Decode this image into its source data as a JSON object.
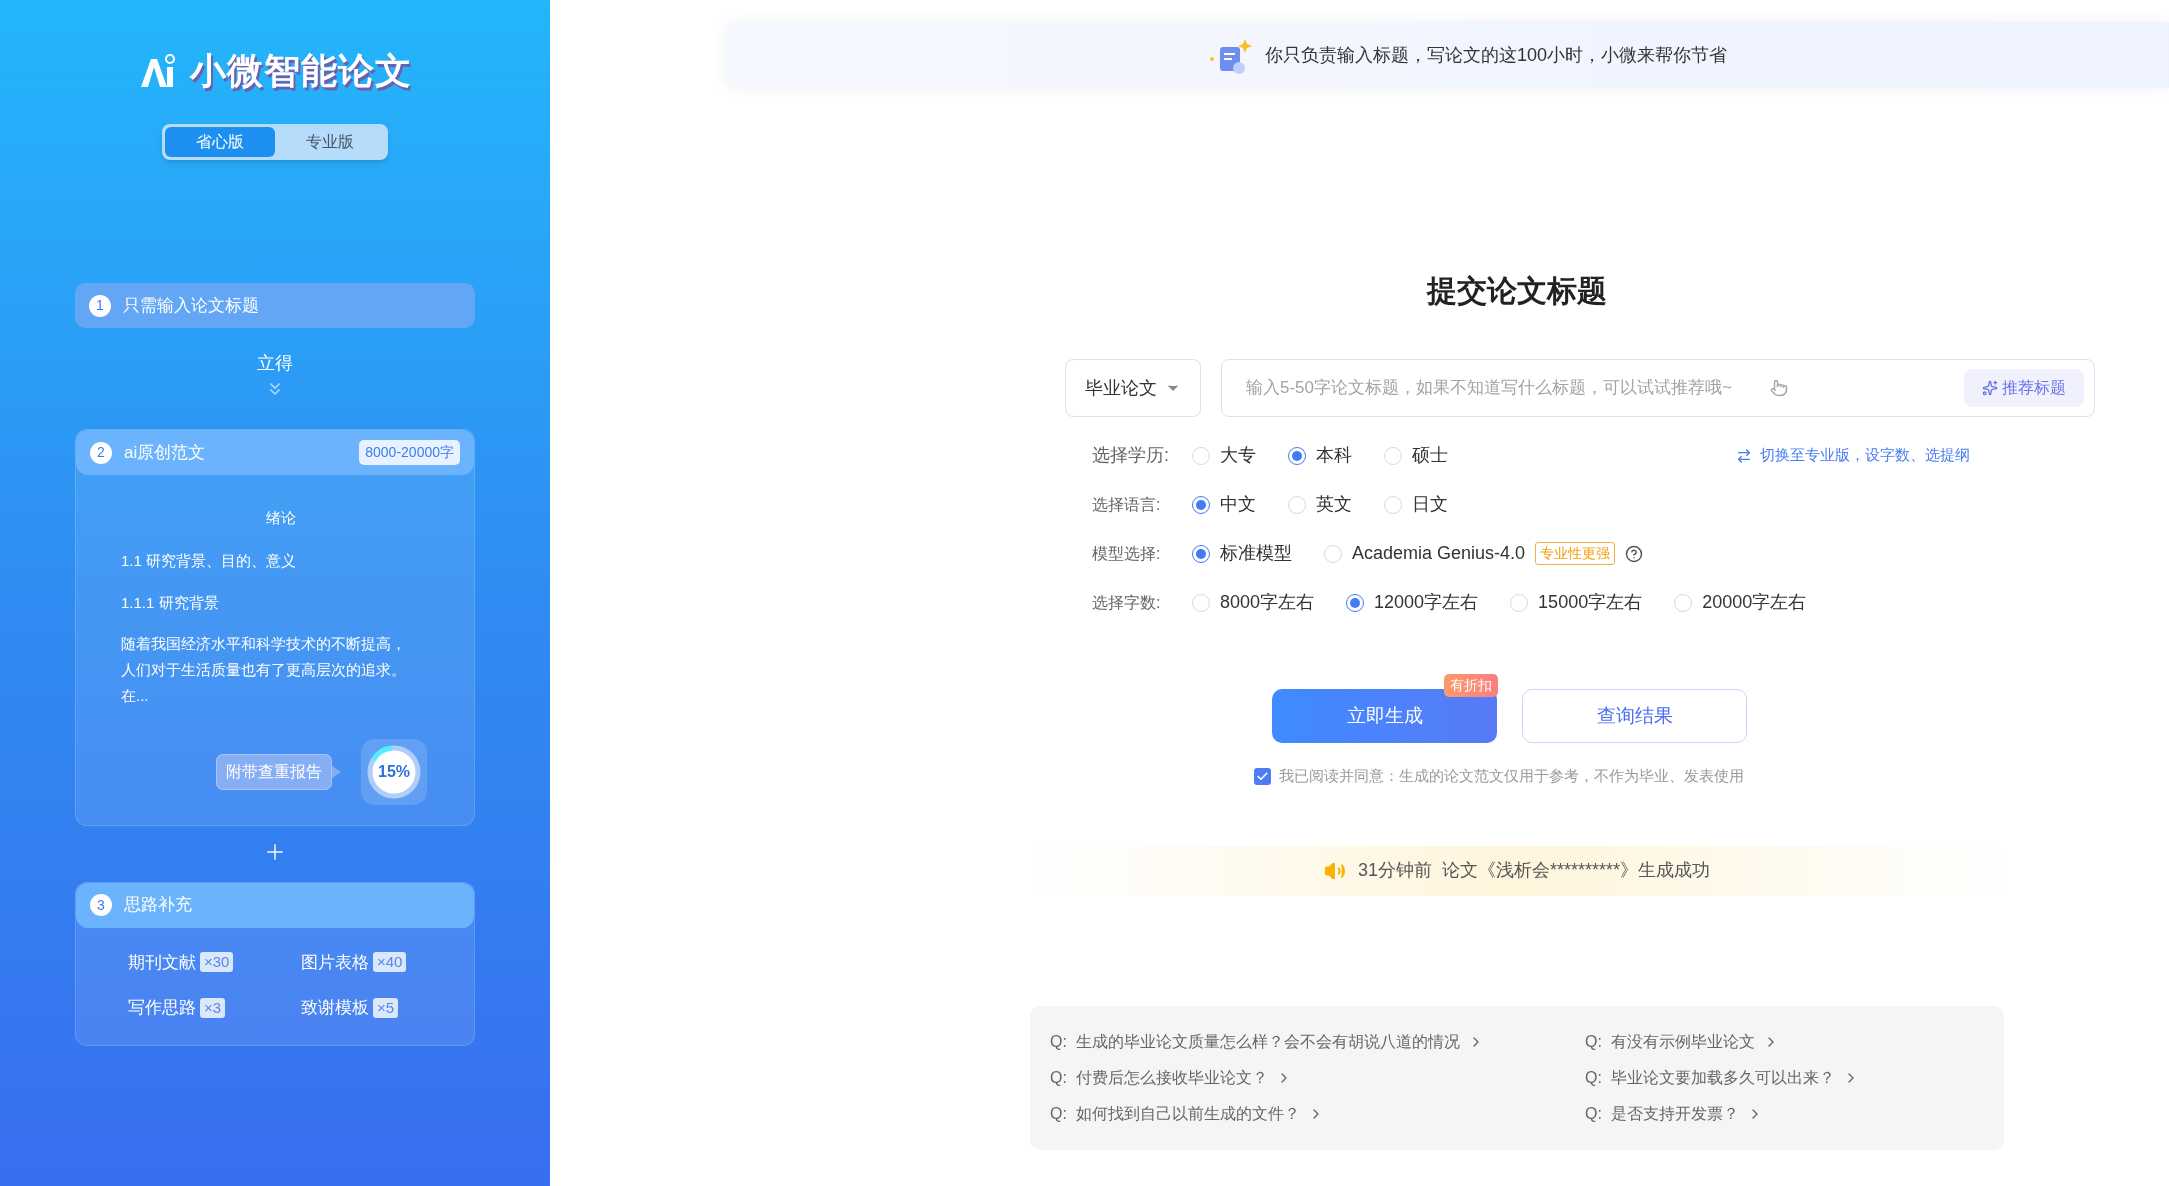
{
  "sidebar": {
    "logo_text": "小微智能论文",
    "version_tabs": [
      {
        "label": "省心版",
        "selected": true
      },
      {
        "label": "专业版",
        "selected": false
      }
    ],
    "step_1": {
      "number": "1",
      "title": "只需输入论文标题"
    },
    "connector_text": "立得",
    "step_2": {
      "number": "2",
      "title": "ai原创范文",
      "badge": "8000-20000字",
      "preview_heading": "绪论",
      "preview_lines": [
        "1.1 研究背景、目的、意义",
        "1.1.1 研究背景"
      ],
      "preview_paragraph": "随着我国经济水平和科学技术的不断提高，人们对于生活质量也有了更高层次的追求。在...",
      "report_label": "附带查重报告",
      "similarity": {
        "text": "15%",
        "level": 0.15
      }
    },
    "step_3": {
      "number": "3",
      "title": "思路补充",
      "items": [
        {
          "label": "期刊文献",
          "count": "×30"
        },
        {
          "label": "图片表格",
          "count": "×40"
        },
        {
          "label": "写作思路",
          "count": "×3"
        },
        {
          "label": "致谢模板",
          "count": "×5"
        }
      ]
    }
  },
  "banner": {
    "text": "你只负责输入标题，写论文的这100小时，小微来帮你节省"
  },
  "main": {
    "title": "提交论文标题",
    "type_dropdown": "毕业论文",
    "title_input": {
      "placeholder": "输入5-50字论文标题，如果不知道写什么标题，可以试试推荐哦~"
    },
    "recommend_button": "推荐标题",
    "switch_link": "切换至专业版，设字数、选提纲",
    "option_rows": [
      {
        "label": "选择学历:",
        "options": [
          {
            "label": "大专",
            "selected": false
          },
          {
            "label": "本科",
            "selected": true
          },
          {
            "label": "硕士",
            "selected": false
          }
        ]
      },
      {
        "label": "选择语言:",
        "options": [
          {
            "label": "中文",
            "selected": true
          },
          {
            "label": "英文",
            "selected": false
          },
          {
            "label": "日文",
            "selected": false
          }
        ]
      },
      {
        "label": "模型选择:",
        "options": [
          {
            "label": "标准模型",
            "selected": true
          },
          {
            "label": "Academia Genius-4.0",
            "selected": false,
            "tag": "专业性更强"
          }
        ],
        "help": true
      },
      {
        "label": "选择字数:",
        "options": [
          {
            "label": "8000字左右",
            "selected": false
          },
          {
            "label": "12000字左右",
            "selected": true
          },
          {
            "label": "15000字左右",
            "selected": false
          },
          {
            "label": "20000字左右",
            "selected": false
          }
        ]
      }
    ],
    "generate_button": {
      "label": "立即生成",
      "badge": "有折扣"
    },
    "query_button": "查询结果",
    "agreement": {
      "checked": true,
      "text": "我已阅读并同意：生成的论文范文仅用于参考，不作为毕业、发表使用"
    },
    "notice": "31分钟前  论文《浅析会**********》生成成功",
    "faq": [
      {
        "text": "Q:  生成的毕业论文质量怎么样？会不会有胡说八道的情况"
      },
      {
        "text": "Q:  有没有示例毕业论文"
      },
      {
        "text": "Q:  付费后怎么接收毕业论文？"
      },
      {
        "text": "Q:  毕业论文要加载多久可以出来？"
      },
      {
        "text": "Q:  如何找到自己以前生成的文件？"
      },
      {
        "text": "Q:  是否支持开发票？"
      }
    ]
  }
}
